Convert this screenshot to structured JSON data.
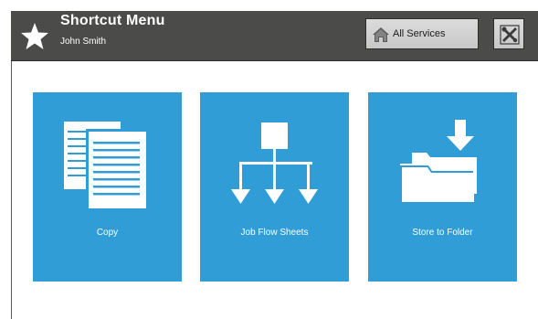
{
  "header": {
    "title": "Shortcut Menu",
    "user": "John Smith",
    "background": "#4b4b49",
    "all_services_label": "All Services"
  },
  "tiles": [
    {
      "label": "Copy",
      "icon": "copy-documents-icon"
    },
    {
      "label": "Job Flow Sheets",
      "icon": "job-flow-icon"
    },
    {
      "label": "Store to Folder",
      "icon": "store-folder-icon"
    }
  ],
  "colors": {
    "tile": "#319dd6",
    "header": "#4b4b49"
  }
}
